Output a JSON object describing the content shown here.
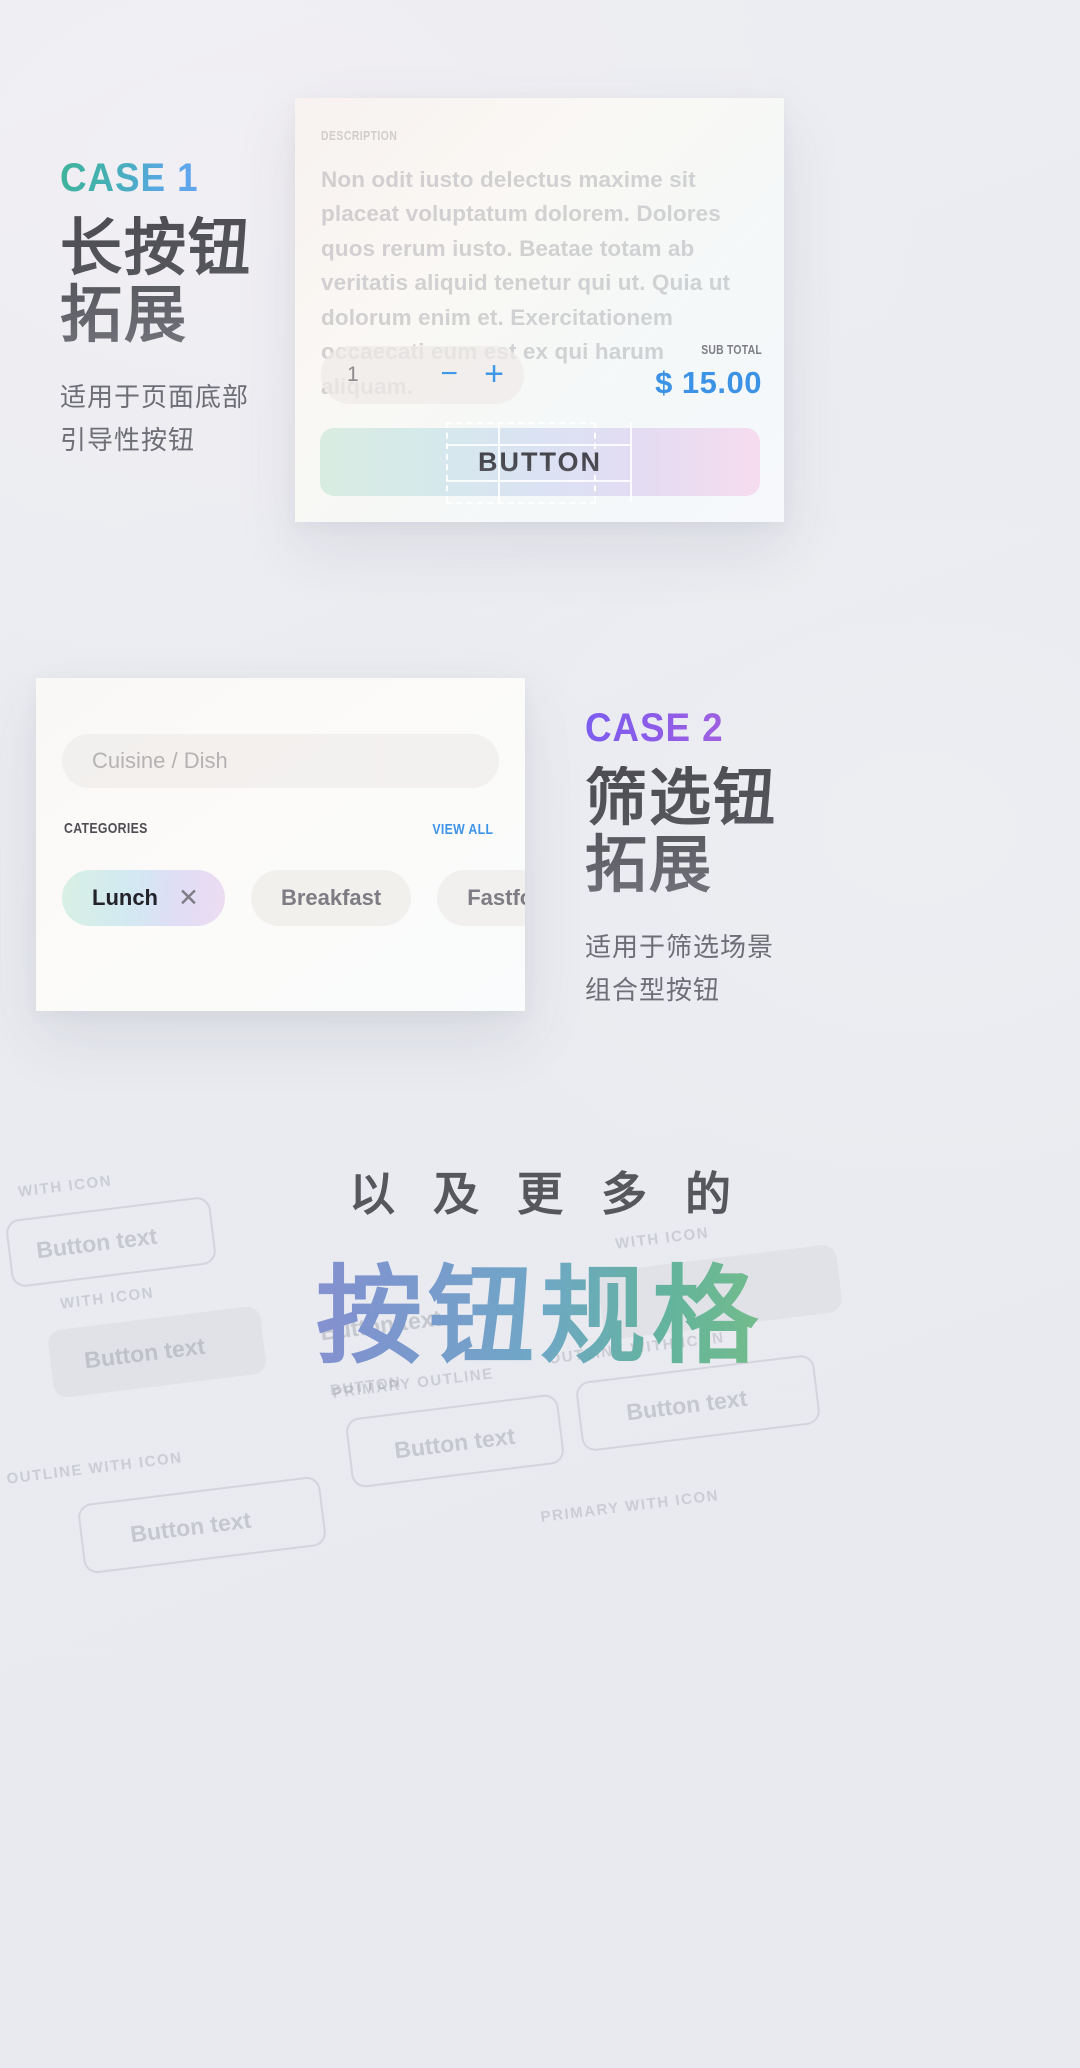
{
  "case1": {
    "label": "CASE 1",
    "heading_line1": "长按钮",
    "heading_line2": "拓展",
    "desc_line1": "适用于页面底部",
    "desc_line2": "引导性按钮",
    "label_gradient_from": "#3fb39a",
    "label_gradient_to": "#64a6f0"
  },
  "case2": {
    "label": "CASE 2",
    "heading_line1": "筛选钮",
    "heading_line2": "拓展",
    "desc_line1": "适用于筛选场景",
    "desc_line2": "组合型按钮",
    "label_gradient_from": "#7b5cf0",
    "label_gradient_to": "#a060e0"
  },
  "product_card": {
    "section_label": "DESCRIPTION",
    "body_text": "Non odit iusto delectus maxime sit placeat voluptatum dolorem. Dolores quos rerum iusto. Beatae totam ab veritatis aliquid tenetur qui ut. Quia ut dolorum enim et. Exercitationem occaecati eum est ex qui harum aliquam.",
    "quantity_value": "1",
    "minus_label": "−",
    "plus_label": "+",
    "stepper_accent": "#3f97e8",
    "subtotal_label": "SUB TOTAL",
    "subtotal_value": "$ 15.00",
    "subtotal_color": "#3c93e6",
    "cta_label": "BUTTON"
  },
  "filter_card": {
    "search_placeholder": "Cuisine / Dish",
    "categories_label": "CATEGORIES",
    "view_all_label": "VIEW ALL",
    "view_all_color": "#3e94e8",
    "chips": [
      {
        "label": "Lunch",
        "selected": true,
        "remove_icon": "✕"
      },
      {
        "label": "Breakfast",
        "selected": false
      },
      {
        "label": "Fastfood",
        "selected": false
      }
    ]
  },
  "hero": {
    "subtitle": "以及更多的",
    "title": "按钮规格",
    "ghost_specimens": [
      {
        "caption": "WITH ICON",
        "text": "Button text"
      },
      {
        "caption": "BUTTON",
        "text": "Button text"
      },
      {
        "caption": "WITH ICON",
        "text": "Button text"
      },
      {
        "caption": "OUTLINE WITH ICON",
        "text": "Button text"
      },
      {
        "caption": "PRIMARY OUTLINE",
        "text": "Button text"
      },
      {
        "caption": "OUTLINE WITH ICON",
        "text": "Button text"
      },
      {
        "caption": "PRIMARY WITH ICON",
        "text": "Button text"
      }
    ]
  }
}
